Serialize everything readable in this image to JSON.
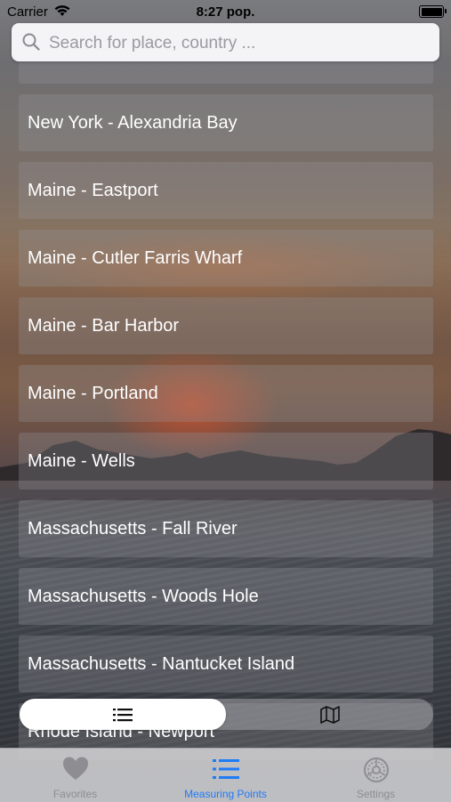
{
  "status_bar": {
    "carrier": "Carrier",
    "time": "8:27 pop."
  },
  "search": {
    "placeholder": "Search for place, country ..."
  },
  "list": {
    "items": [
      {
        "label": ""
      },
      {
        "label": "New York - Alexandria Bay"
      },
      {
        "label": "Maine - Eastport"
      },
      {
        "label": "Maine - Cutler Farris Wharf"
      },
      {
        "label": "Maine - Bar Harbor"
      },
      {
        "label": "Maine - Portland"
      },
      {
        "label": "Maine - Wells"
      },
      {
        "label": "Massachusetts - Fall River"
      },
      {
        "label": "Massachusetts - Woods Hole"
      },
      {
        "label": "Massachusetts - Nantucket Island"
      },
      {
        "label": "Rhode Island - Newport"
      }
    ]
  },
  "view_switch": {
    "options": [
      {
        "icon": "list-icon",
        "selected": true
      },
      {
        "icon": "map-icon",
        "selected": false
      }
    ]
  },
  "tab_bar": {
    "tabs": [
      {
        "label": "Favorites",
        "icon": "heart-icon",
        "active": false
      },
      {
        "label": "Measuring Points",
        "icon": "list-icon",
        "active": true
      },
      {
        "label": "Settings",
        "icon": "gear-icon",
        "active": false
      }
    ],
    "active_color": "#1f7bf6",
    "inactive_color": "#8d8d92"
  }
}
